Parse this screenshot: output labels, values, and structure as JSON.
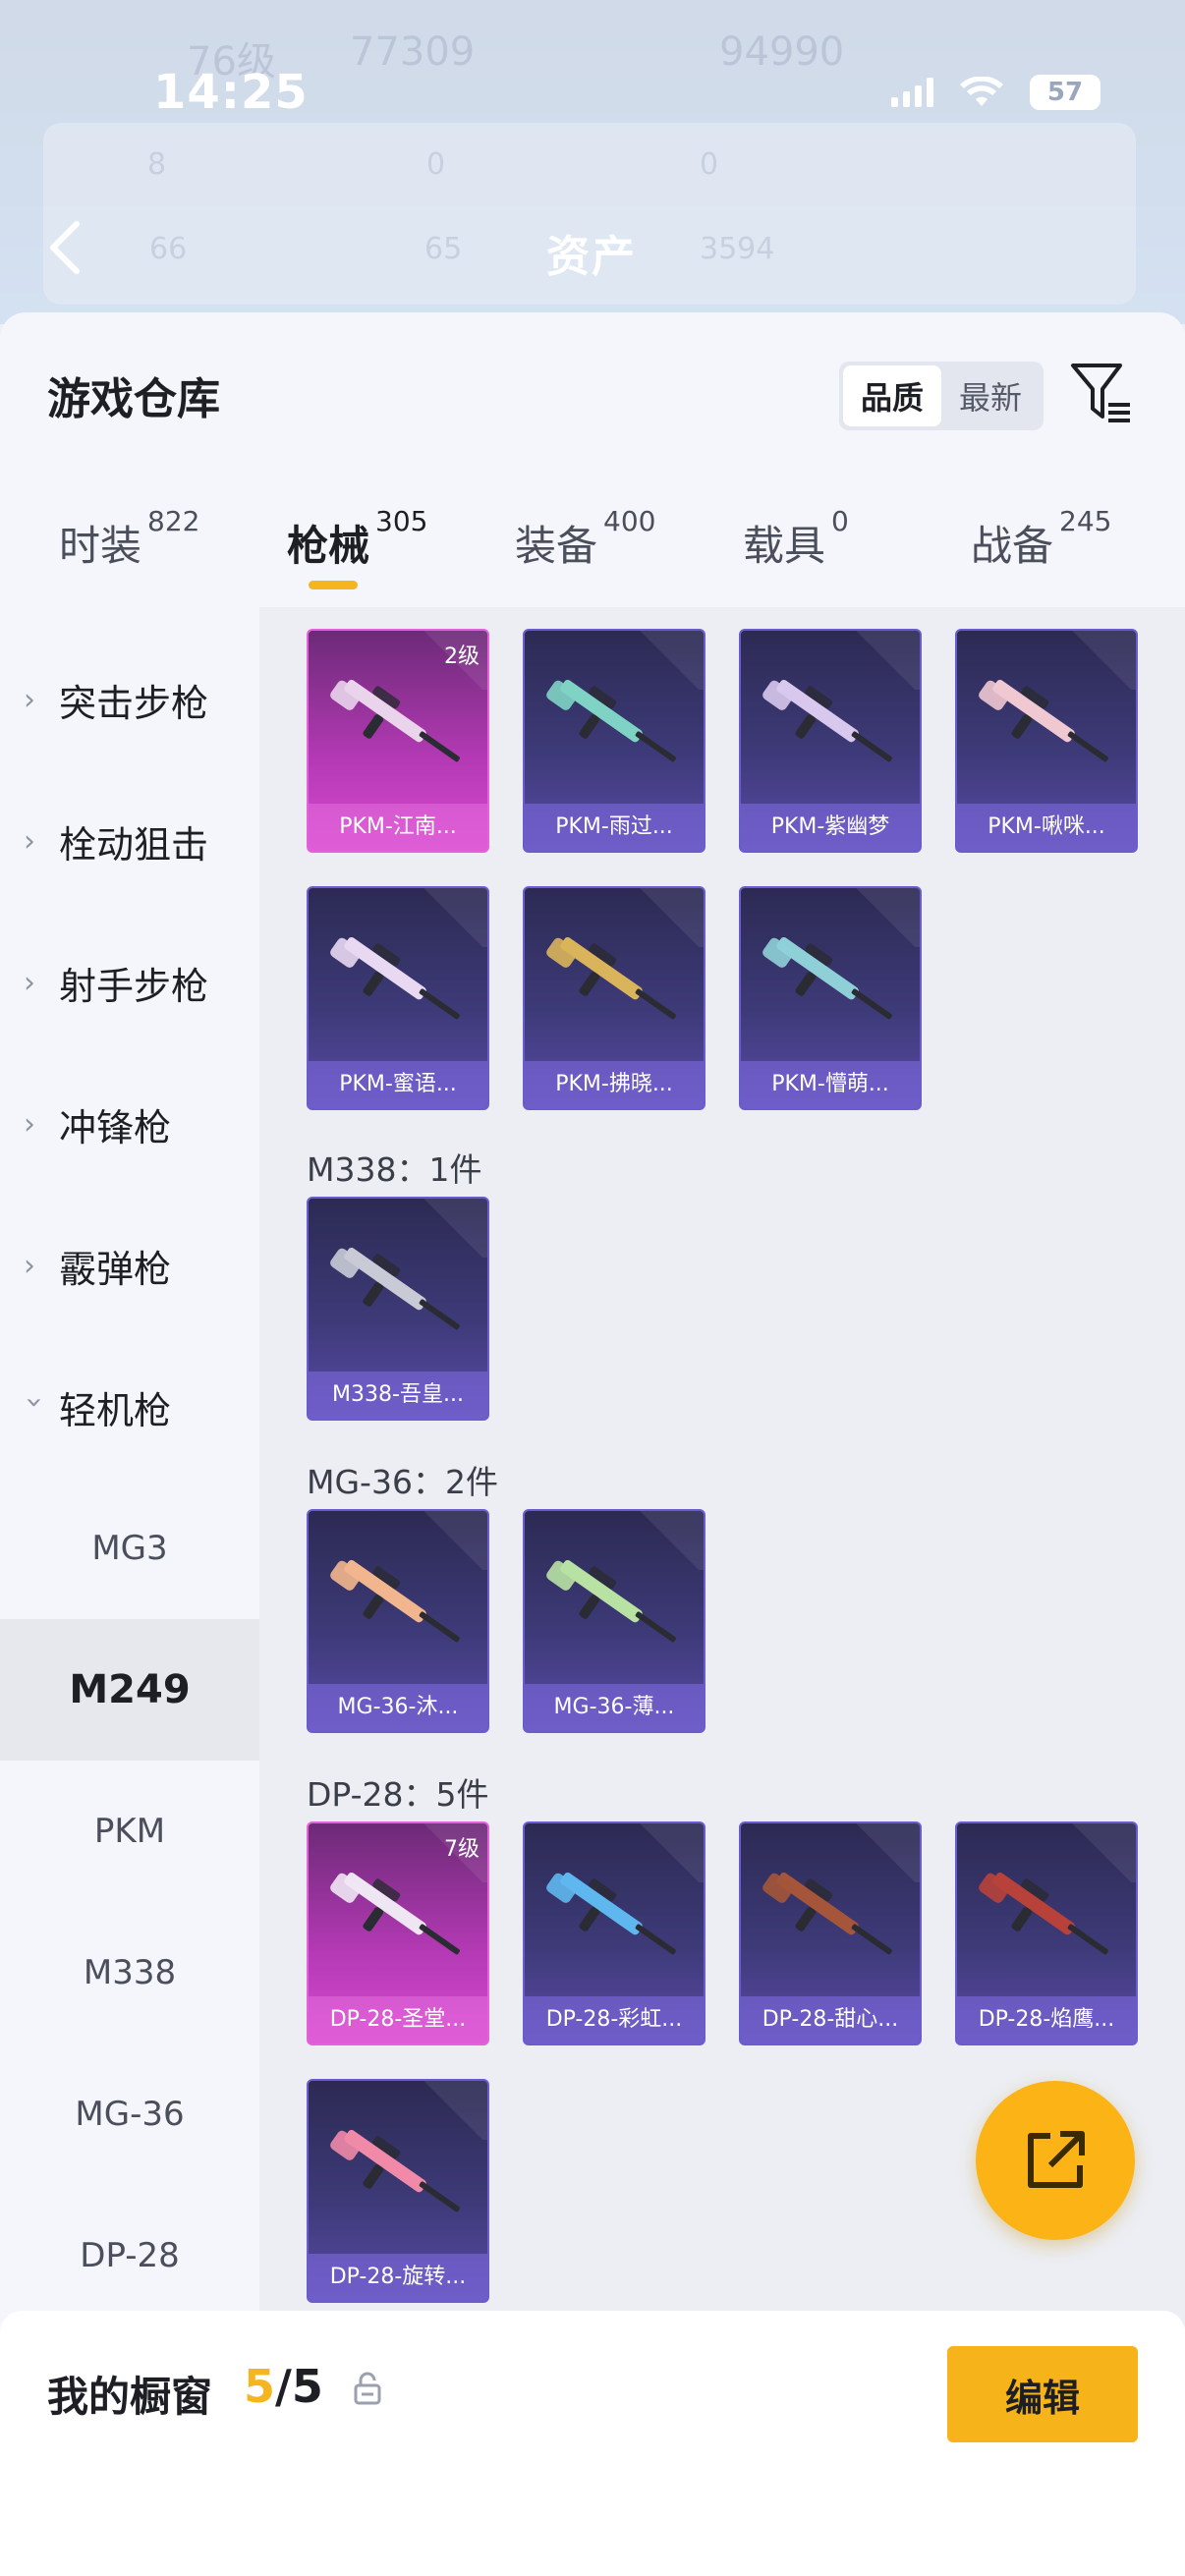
{
  "status_bar": {
    "time": "14:25",
    "battery": "57"
  },
  "header": {
    "title": "资产",
    "ghost": {
      "level": "76级",
      "coins": "77309",
      "points": "94990",
      "stat_a": "8",
      "stat_b": "0",
      "stat_c": "0",
      "stat_d": "66",
      "stat_e": "65",
      "stat_f": "3594"
    }
  },
  "warehouse": {
    "title": "游戏仓库",
    "sort": {
      "quality": "品质",
      "newest": "最新"
    }
  },
  "tabs": [
    {
      "label": "时装",
      "count": "822"
    },
    {
      "label": "枪械",
      "count": "305"
    },
    {
      "label": "装备",
      "count": "400"
    },
    {
      "label": "载具",
      "count": "0"
    },
    {
      "label": "战备",
      "count": "245"
    }
  ],
  "sidebar": {
    "categories": [
      "突击步枪",
      "栓动狙击",
      "射手步枪",
      "冲锋枪",
      "霰弹枪",
      "轻机枪"
    ],
    "subitems": [
      "MG3",
      "M249",
      "PKM",
      "M338",
      "MG-36",
      "DP-28"
    ]
  },
  "groups": {
    "pkm": {
      "items": [
        {
          "name": "PKM-江南...",
          "level": "2级"
        },
        {
          "name": "PKM-雨过..."
        },
        {
          "name": "PKM-紫幽梦"
        },
        {
          "name": "PKM-啾咪..."
        },
        {
          "name": "PKM-蜜语..."
        },
        {
          "name": "PKM-拂晓..."
        },
        {
          "name": "PKM-懵萌..."
        }
      ]
    },
    "m338": {
      "header": "M338：1件",
      "items": [
        {
          "name": "M338-吾皇..."
        }
      ]
    },
    "mg36": {
      "header": "MG-36：2件",
      "items": [
        {
          "name": "MG-36-沐..."
        },
        {
          "name": "MG-36-薄..."
        }
      ]
    },
    "dp28": {
      "header": "DP-28：5件",
      "items": [
        {
          "name": "DP-28-圣堂...",
          "level": "7级"
        },
        {
          "name": "DP-28-彩虹..."
        },
        {
          "name": "DP-28-甜心..."
        },
        {
          "name": "DP-28-焰鹰..."
        },
        {
          "name": "DP-28-旋转..."
        }
      ]
    }
  },
  "showcase": {
    "label": "我的橱窗",
    "current": "5",
    "total": "/5",
    "edit": "编辑"
  },
  "colors": {
    "accent": "#f5b51f",
    "card_purple": "#3d3a78",
    "card_rare": "#b63ab6"
  }
}
